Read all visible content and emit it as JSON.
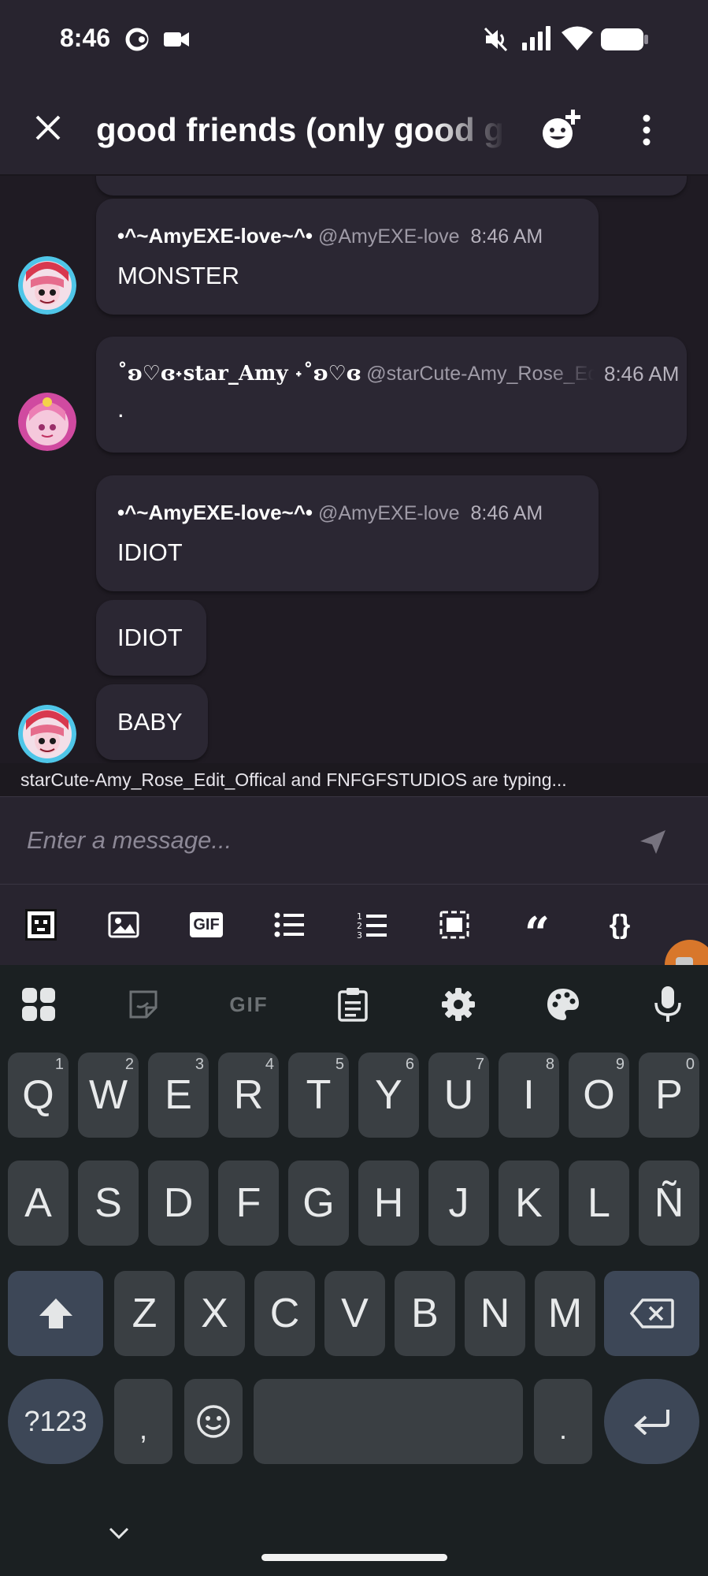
{
  "status_bar": {
    "time": "8:46"
  },
  "header": {
    "title": "good friends (only good guys)"
  },
  "messages": [
    {
      "name": "•^~AmyEXE-love~^•",
      "handle": "@AmyEXE-love",
      "time": "8:46 AM",
      "text": "MONSTER"
    },
    {
      "name": "˚ʚ♡ɞ˖star_Amy ˖˚ʚ♡ɞ",
      "handle": "@starCute-Amy_Rose_Edit_Offical",
      "time": "8:46 AM",
      "text": "."
    },
    {
      "name": "•^~AmyEXE-love~^•",
      "handle": "@AmyEXE-love",
      "time": "8:46 AM",
      "text": "IDIOT"
    },
    {
      "text": "IDIOT"
    },
    {
      "text": "BABY"
    }
  ],
  "typing_indicator": "starCute-Amy_Rose_Edit_Offical and FNFGFSTUDIOS are typing...",
  "composer": {
    "placeholder": "Enter a message..."
  },
  "toolbar": {
    "gif_label": "GIF",
    "quote_label": "“",
    "code_label": "{}"
  },
  "keyboard": {
    "top_gif_label": "GIF",
    "row1": [
      {
        "k": "Q",
        "h": "1"
      },
      {
        "k": "W",
        "h": "2"
      },
      {
        "k": "E",
        "h": "3"
      },
      {
        "k": "R",
        "h": "4"
      },
      {
        "k": "T",
        "h": "5"
      },
      {
        "k": "Y",
        "h": "6"
      },
      {
        "k": "U",
        "h": "7"
      },
      {
        "k": "I",
        "h": "8"
      },
      {
        "k": "O",
        "h": "9"
      },
      {
        "k": "P",
        "h": "0"
      }
    ],
    "row2": [
      "A",
      "S",
      "D",
      "F",
      "G",
      "H",
      "J",
      "K",
      "L",
      "Ñ"
    ],
    "row3": [
      "Z",
      "X",
      "C",
      "V",
      "B",
      "N",
      "M"
    ],
    "symbols_label": "?123",
    "comma_label": ",",
    "period_label": "."
  }
}
